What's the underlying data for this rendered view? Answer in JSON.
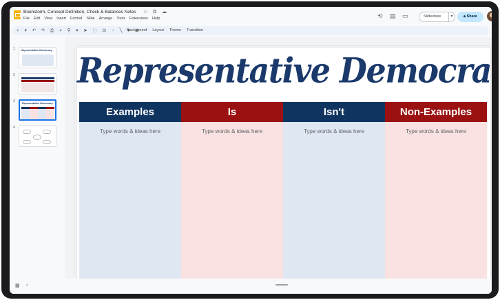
{
  "app": {
    "doc_title": "Brainstorm, Concept Definition, Check & Balances Notes",
    "title_icons": "☆ ⧉ ☁",
    "menu": [
      "File",
      "Edit",
      "View",
      "Insert",
      "Format",
      "Slide",
      "Arrange",
      "Tools",
      "Extensions",
      "Help"
    ]
  },
  "header": {
    "slideshow_label": "Slideshow",
    "slideshow_arrow": "▾",
    "share_label": "Share",
    "history_icon": "⟲",
    "comments_icon": "▤",
    "meet_icon": "▭"
  },
  "toolbar": {
    "icons": "+ ▾ ↶ ↷ ⎙ ⌖ ⚲ ▾ ➤ ⬚ ⊡ ◔ ╲ ▾ ⊞",
    "labels": [
      "Background",
      "Layout",
      "Theme",
      "Transition"
    ]
  },
  "filmstrip": {
    "slides": [
      {
        "num": "1",
        "title": "Representative Democracy"
      },
      {
        "num": "2",
        "title": ""
      },
      {
        "num": "3",
        "title": "Representative Democracy"
      },
      {
        "num": "4",
        "title": ""
      }
    ]
  },
  "slide": {
    "title": "Representative Democracy",
    "columns": [
      {
        "header": "Examples",
        "hint": "Type words & ideas here",
        "head_color": "#0f3460",
        "body_color": "#dfe8f2"
      },
      {
        "header": "Is",
        "hint": "Type words & ideas here",
        "head_color": "#9b1111",
        "body_color": "#f9e2e1"
      },
      {
        "header": "Isn't",
        "hint": "Type words & ideas here",
        "head_color": "#0f3460",
        "body_color": "#dfe8f2"
      },
      {
        "header": "Non-Examples",
        "hint": "Type words & ideas here",
        "head_color": "#9b1111",
        "body_color": "#f9e2e1"
      }
    ]
  },
  "colors": {
    "title_blue": "#1b3a6b",
    "share_bg": "#c2e7ff",
    "accent_blue": "#1a73e8"
  }
}
